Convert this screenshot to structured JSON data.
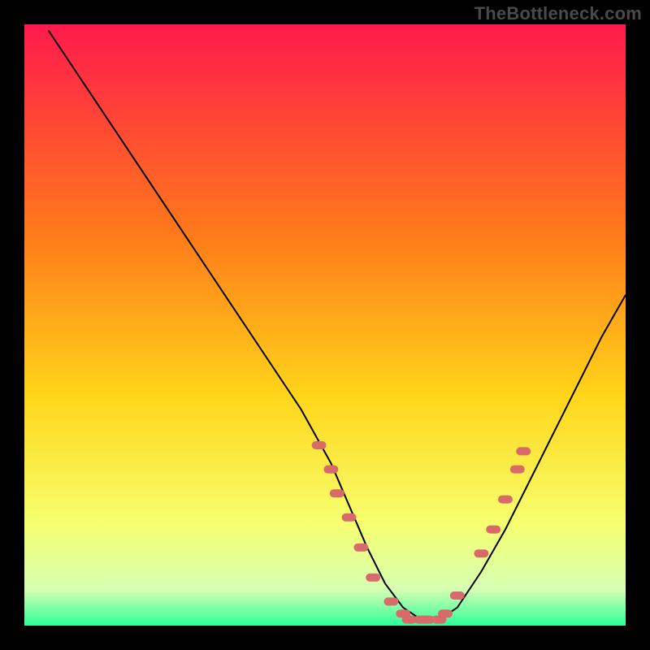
{
  "watermark": "TheBottleneck.com",
  "colors": {
    "bg": "#000000",
    "gradient_top": "#ff1a4d",
    "gradient_mid1": "#ff7a1a",
    "gradient_mid2": "#ffd61a",
    "gradient_lower": "#f6ff6e",
    "gradient_base1": "#d6ffb3",
    "gradient_base2": "#2dff9a",
    "curve": "#000000",
    "marker": "#d86a6a"
  },
  "chart_data": {
    "type": "line",
    "title": "",
    "xlabel": "",
    "ylabel": "",
    "xlim": [
      0,
      100
    ],
    "ylim": [
      0,
      100
    ],
    "grid": false,
    "legend": false,
    "series": [
      {
        "name": "curve",
        "x": [
          4,
          10,
          16,
          22,
          28,
          34,
          40,
          46,
          51,
          54,
          57,
          60,
          63,
          66,
          69,
          72,
          76,
          80,
          84,
          88,
          92,
          96,
          100
        ],
        "y": [
          99,
          90,
          81,
          72,
          63,
          54,
          45,
          36,
          27,
          20,
          13,
          7,
          3,
          1,
          1,
          3,
          9,
          16,
          24,
          32,
          40,
          48,
          55
        ]
      }
    ],
    "markers": [
      {
        "x": 49,
        "y": 30
      },
      {
        "x": 51,
        "y": 26
      },
      {
        "x": 52,
        "y": 22
      },
      {
        "x": 54,
        "y": 18
      },
      {
        "x": 56,
        "y": 13
      },
      {
        "x": 58,
        "y": 8
      },
      {
        "x": 61,
        "y": 4
      },
      {
        "x": 63,
        "y": 2
      },
      {
        "x": 64,
        "y": 1
      },
      {
        "x": 66,
        "y": 1
      },
      {
        "x": 67,
        "y": 1
      },
      {
        "x": 69,
        "y": 1
      },
      {
        "x": 70,
        "y": 2
      },
      {
        "x": 72,
        "y": 5
      },
      {
        "x": 76,
        "y": 12
      },
      {
        "x": 78,
        "y": 16
      },
      {
        "x": 80,
        "y": 21
      },
      {
        "x": 82,
        "y": 26
      },
      {
        "x": 83,
        "y": 29
      }
    ]
  }
}
